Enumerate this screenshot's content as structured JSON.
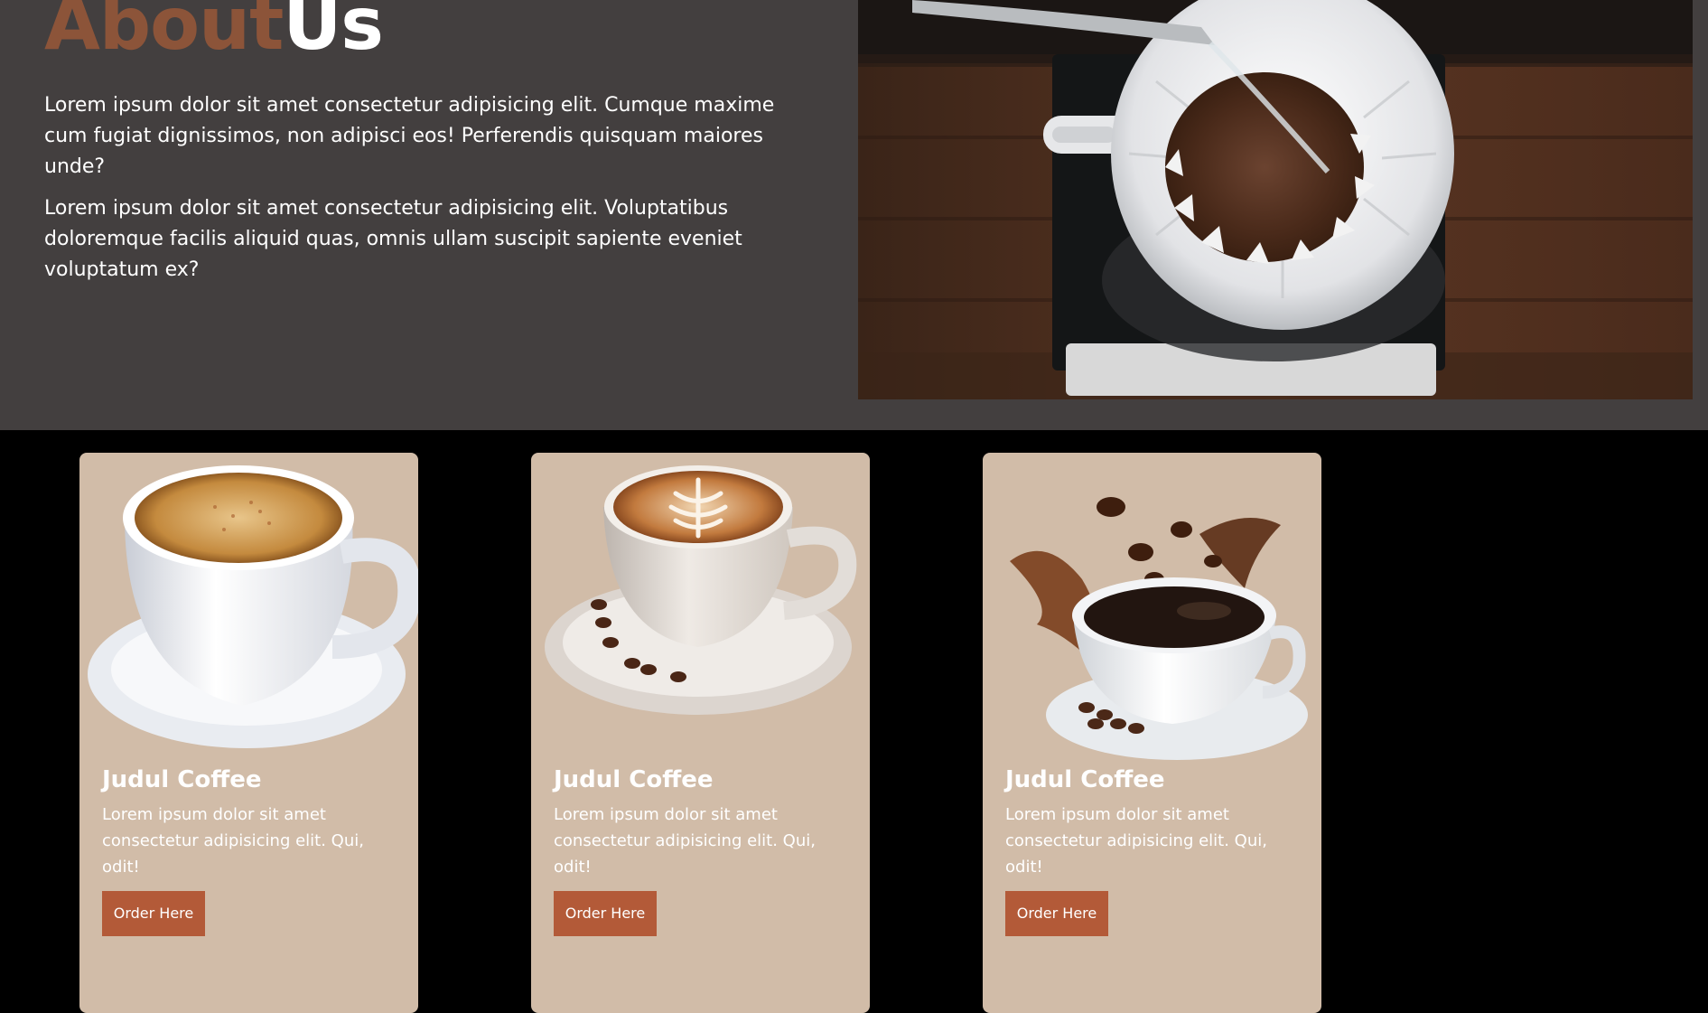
{
  "about": {
    "title_part1": "About",
    "title_part2": "Us",
    "paragraphs": [
      "Lorem ipsum dolor sit amet consectetur adipisicing elit. Cumque maxime cum fugiat dignissimos, non adipisci eos! Perferendis quisquam maiores unde?",
      "Lorem ipsum dolor sit amet consectetur adipisicing elit. Voluptatibus doloremque facilis aliquid quas, omnis ullam suscipit sapiente eveniet voluptatum ex?"
    ],
    "photo_icon": "pour-over-coffee-photo"
  },
  "menu": {
    "cards": [
      {
        "title": "Judul Coffee",
        "description": "Lorem ipsum dolor sit amet consectetur adipisicing elit. Qui, odit!",
        "button_label": "Order Here",
        "image_icon": "cappuccino-cup-image"
      },
      {
        "title": "Judul Coffee",
        "description": "Lorem ipsum dolor sit amet consectetur adipisicing elit. Qui, odit!",
        "button_label": "Order Here",
        "image_icon": "latte-art-cup-image"
      },
      {
        "title": "Judul Coffee",
        "description": "Lorem ipsum dolor sit amet consectetur adipisicing elit. Qui, odit!",
        "button_label": "Order Here",
        "image_icon": "coffee-splash-cup-image"
      }
    ]
  },
  "colors": {
    "about_background": "#433f3f",
    "accent_brown": "#8c5439",
    "card_background": "#d1bca8",
    "button_background": "#b35a38",
    "page_background": "#000000"
  }
}
